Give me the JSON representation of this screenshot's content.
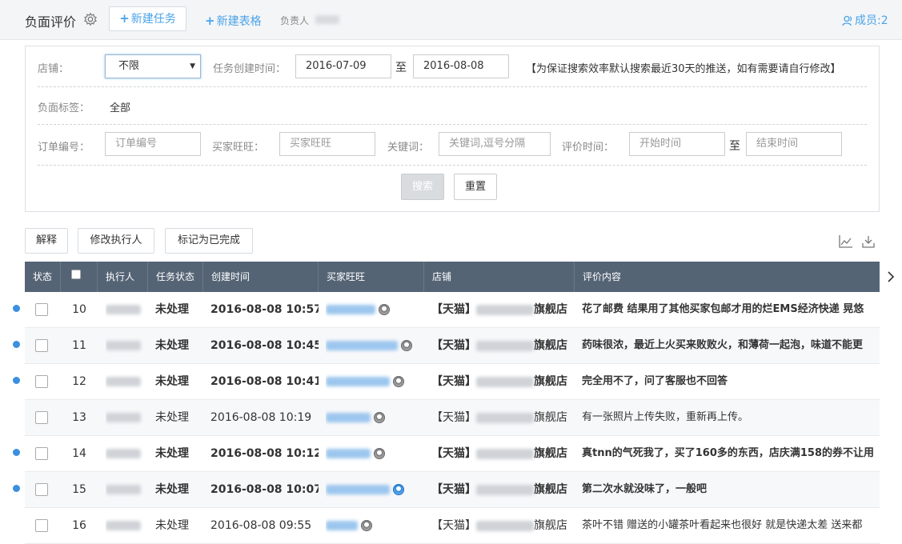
{
  "header": {
    "title": "负面评价",
    "new_task": "新建任务",
    "new_table": "新建表格",
    "owner_label": "负责人",
    "members": "成员:2"
  },
  "filters": {
    "shop_label": "店铺：",
    "shop_value": "不限",
    "task_time_label": "任务创建时间：",
    "date_from": "2016-07-09",
    "date_to": "2016-08-08",
    "to_sep": "至",
    "note": "【为保证搜索效率默认搜索最近30天的推送，如有需要请自行修改】",
    "neg_tag_label": "负面标签：",
    "neg_tag_value": "全部",
    "order_label": "订单编号：",
    "order_placeholder": "订单编号",
    "buyer_label": "买家旺旺：",
    "buyer_placeholder": "买家旺旺",
    "keyword_label": "关键词：",
    "keyword_placeholder": "关键词,逗号分隔",
    "eval_time_label": "评价时间：",
    "start_placeholder": "开始时间",
    "end_placeholder": "结束时间",
    "search": "搜索",
    "reset": "重置"
  },
  "actions": {
    "explain": "解释",
    "change_assignee": "修改执行人",
    "mark_done": "标记为已完成"
  },
  "table": {
    "columns": [
      "状态",
      "",
      "执行人",
      "任务状态",
      "创建时间",
      "买家旺旺",
      "店铺",
      "评价内容"
    ],
    "rows": [
      {
        "no": "10",
        "status": "未处理",
        "time": "2016-08-08 10:57",
        "shop_prefix": "【天猫】",
        "shop_suffix": "旗舰店",
        "content": "花了邮费 结果用了其他买家包邮才用的烂EMS经济快递 晃悠",
        "bold": true,
        "dot": true
      },
      {
        "no": "11",
        "status": "未处理",
        "time": "2016-08-08 10:45",
        "shop_prefix": "【天猫】",
        "shop_suffix": "旗舰店",
        "content": "药味很浓，最近上火买来败败火，和薄荷一起泡，味道不能更",
        "bold": true,
        "dot": true
      },
      {
        "no": "12",
        "status": "未处理",
        "time": "2016-08-08 10:41",
        "shop_prefix": "【天猫】",
        "shop_suffix": "旗舰店",
        "content": "完全用不了，问了客服也不回答",
        "bold": true,
        "dot": true
      },
      {
        "no": "13",
        "status": "未处理",
        "time": "2016-08-08 10:19",
        "shop_prefix": "【天猫】",
        "shop_suffix": "旗舰店",
        "content": "有一张照片上传失败，重新再上传。",
        "bold": false,
        "dot": false
      },
      {
        "no": "14",
        "status": "未处理",
        "time": "2016-08-08 10:12",
        "shop_prefix": "【天猫】",
        "shop_suffix": "旗舰店",
        "content": "真tnn的气死我了，买了160多的东西，店庆满158的券不让用",
        "bold": true,
        "dot": true
      },
      {
        "no": "15",
        "status": "未处理",
        "time": "2016-08-08 10:07",
        "shop_prefix": "【天猫】",
        "shop_suffix": "旗舰店",
        "content": "第二次水就没味了，一般吧",
        "bold": true,
        "dot": true
      },
      {
        "no": "16",
        "status": "未处理",
        "time": "2016-08-08 09:55",
        "shop_prefix": "【天猫】",
        "shop_suffix": "旗舰店",
        "content": "茶叶不错 赠送的小罐茶叶看起来也很好 就是快递太差 送来都",
        "bold": false,
        "dot": false
      }
    ]
  },
  "icons": {
    "gear": "gear-icon",
    "members": "users-icon",
    "chart": "line-chart-icon",
    "download": "download-icon",
    "scroll": "chevron-right-icon"
  },
  "colors": {
    "accent": "#4aa3e8",
    "table_header": "#556475",
    "unread_dot": "#3b8fe0"
  }
}
